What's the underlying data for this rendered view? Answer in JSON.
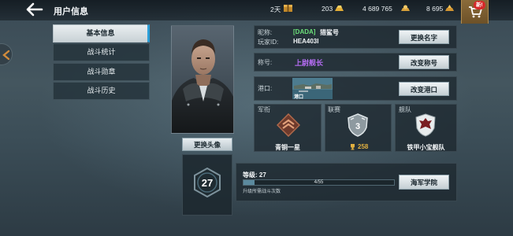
{
  "header": {
    "title": "用户信息",
    "days": "2天",
    "resource_1": "203",
    "resource_2": "4 689 765",
    "resource_3": "8 695",
    "cart_badge": "新!"
  },
  "menu": {
    "items": [
      {
        "label": "基本信息",
        "active": true
      },
      {
        "label": "战斗统计",
        "active": false
      },
      {
        "label": "战斗勋章",
        "active": false
      },
      {
        "label": "战斗历史",
        "active": false
      }
    ]
  },
  "profile": {
    "change_avatar_label": "更换头像",
    "level_number": "27",
    "nickname_label": "昵称:",
    "nickname_tag": "[DADA]",
    "nickname": "猎鲨号",
    "player_id_label": "玩家ID:",
    "player_id": "HEA403I",
    "change_name_label": "更换名字",
    "title_label": "称号:",
    "title_value": "上尉舰长",
    "change_title_label": "改变称号",
    "port_label": "港口:",
    "port_name": "港口",
    "change_port_label": "改变港口"
  },
  "cards": {
    "rank": {
      "label": "军衔",
      "value": "青铜一星"
    },
    "league": {
      "label": "联赛",
      "badge_number": "3",
      "points": "258"
    },
    "fleet": {
      "label": "舰队",
      "value": "铁甲小宝舰队"
    }
  },
  "level_progress": {
    "level_label": "等级: 27",
    "progress_text": "4/55",
    "current": 4,
    "max": 55,
    "hint": "升级所需战斗次数",
    "academy_label": "海军学院"
  },
  "colors": {
    "accent_blue": "#2c9fd8",
    "title_purple": "#b36cf0",
    "tag_green": "#6ce07a",
    "gold": "#e0b040",
    "badge_red": "#d62a2a"
  }
}
